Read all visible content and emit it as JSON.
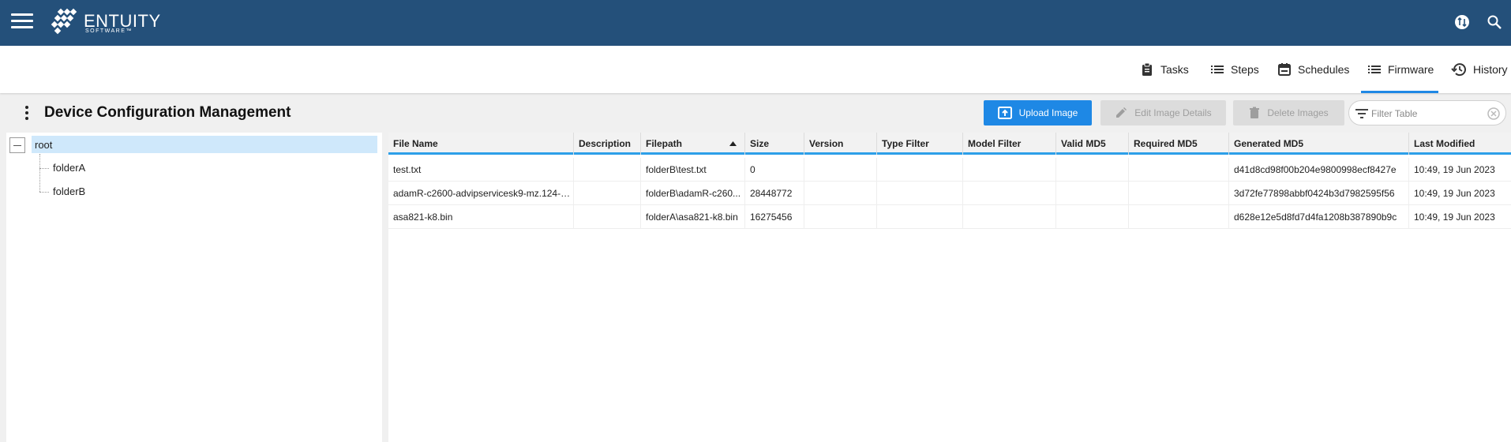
{
  "header": {
    "brand_name": "ENTUITY",
    "brand_sub": "SOFTWARE™",
    "icons": [
      "hamburger-menu-icon",
      "entuity-logo-icon",
      "user-switch-icon",
      "search-icon"
    ]
  },
  "nav": {
    "tabs": [
      {
        "label": "Tasks",
        "icon": "clipboard-icon"
      },
      {
        "label": "Steps",
        "icon": "list-icon"
      },
      {
        "label": "Schedules",
        "icon": "calendar-icon"
      },
      {
        "label": "Firmware",
        "icon": "list-icon",
        "active": true
      },
      {
        "label": "History",
        "icon": "history-icon"
      }
    ]
  },
  "toolbar": {
    "title": "Device Configuration Management",
    "upload_label": "Upload Image",
    "edit_label": "Edit Image Details",
    "delete_label": "Delete Images",
    "filter_placeholder": "Filter Table"
  },
  "tree": {
    "root": "root",
    "children": [
      "folderA",
      "folderB"
    ]
  },
  "table": {
    "columns": [
      "File Name",
      "Description",
      "Filepath",
      "Size",
      "Version",
      "Type Filter",
      "Model Filter",
      "Valid MD5",
      "Required MD5",
      "Generated MD5",
      "Last Modified"
    ],
    "sorted_column": "Filepath",
    "sort_direction": "ascending",
    "rows": [
      {
        "file_name": "test.txt",
        "description": "",
        "filepath": "folderB\\test.txt",
        "size": "0",
        "version": "",
        "type_filter": "",
        "model_filter": "",
        "valid_md5": "",
        "required_md5": "",
        "generated_md5": "d41d8cd98f00b204e9800998ecf8427e",
        "last_modified": "10:49, 19 Jun 2023"
      },
      {
        "file_name": "adamR-c2600-advipservicesk9-mz.124-1...",
        "description": "",
        "filepath": "folderB\\adamR-c260...",
        "size": "28448772",
        "version": "",
        "type_filter": "",
        "model_filter": "",
        "valid_md5": "",
        "required_md5": "",
        "generated_md5": "3d72fe77898abbf0424b3d7982595f56",
        "last_modified": "10:49, 19 Jun 2023"
      },
      {
        "file_name": "asa821-k8.bin",
        "description": "",
        "filepath": "folderA\\asa821-k8.bin",
        "size": "16275456",
        "version": "",
        "type_filter": "",
        "model_filter": "",
        "valid_md5": "",
        "required_md5": "",
        "generated_md5": "d628e12e5d8fd7d4fa1208b387890b9c",
        "last_modified": "10:49, 19 Jun 2023"
      }
    ]
  },
  "colors": {
    "header_bg": "#24507a",
    "accent": "#1e88e5",
    "selected_bg": "#cfe8fb"
  }
}
